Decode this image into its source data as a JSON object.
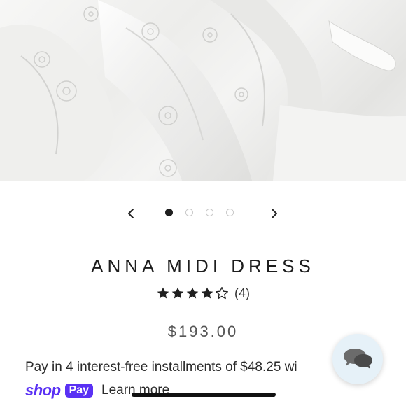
{
  "product": {
    "title": "ANNA MIDI DRESS",
    "rating": 4,
    "rating_max": 5,
    "review_count": "(4)",
    "price": "$193.00"
  },
  "carousel": {
    "slide_count": 4,
    "active_slide": 1,
    "prev_icon": "chevron-left-icon",
    "next_icon": "chevron-right-icon"
  },
  "payment": {
    "installments_text": "Pay in 4 interest-free installments of $48.25 wi",
    "shop_word": "shop",
    "pay_badge": "Pay",
    "learn_more": "Learn more",
    "brand_color": "#5a31f4"
  },
  "chat": {
    "icon": "chat-bubbles-icon",
    "bg_color": "#e6f1f8"
  }
}
